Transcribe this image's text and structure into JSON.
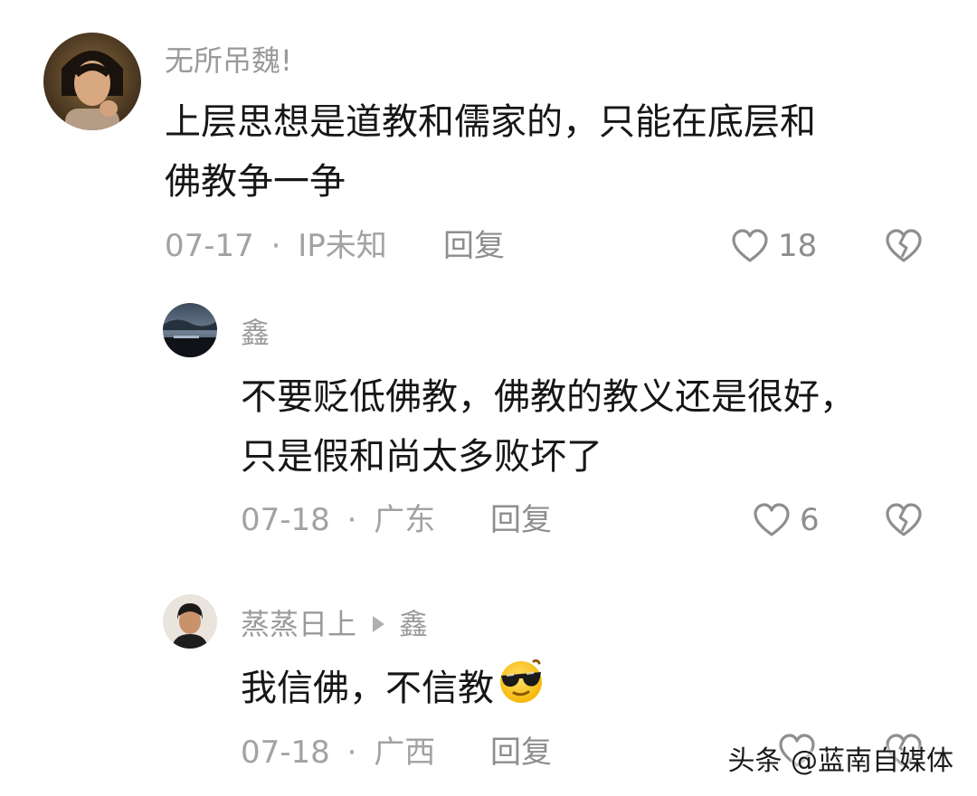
{
  "comments": [
    {
      "username": "无所吊魏!",
      "content_lines": [
        "上层思想是道教和儒家的，只能在底层和",
        "佛教争一争"
      ],
      "date": "07-17",
      "separator": "·",
      "location": "IP未知",
      "reply_label": "回复",
      "likes": "18"
    },
    {
      "username": "鑫",
      "content_lines": [
        "不要贬低佛教，佛教的教义还是很好，",
        "只是假和尚太多败坏了"
      ],
      "date": "07-18",
      "separator": "·",
      "location": "广东",
      "reply_label": "回复",
      "likes": "6"
    },
    {
      "username": "蒸蒸日上",
      "reply_to": "鑫",
      "content_lines": [
        "我信佛，不信教"
      ],
      "date": "07-18",
      "separator": "·",
      "location": "广西",
      "reply_label": "回复"
    }
  ],
  "icons": {
    "like": "heart-outline-icon",
    "dislike": "broken-heart-icon",
    "reply_arrow": "triangle-right-icon",
    "emoji": "cool-sunglasses-emoji"
  },
  "watermark": "头条 @蓝南自媒体",
  "colors": {
    "text_primary": "#161616",
    "text_secondary": "#9a9a9a",
    "icon_gray": "#8e8e8e",
    "background": "#ffffff"
  }
}
